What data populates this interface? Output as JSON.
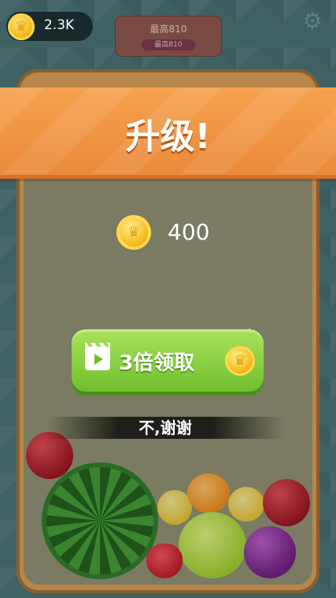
{
  "hud": {
    "coin_balance": "2.3K",
    "best_title": "最高810",
    "best_sub": "最高810"
  },
  "icons": {
    "coin": "coin-crown-icon",
    "settings": "gear-icon",
    "video": "video-clapper-icon"
  },
  "banner": {
    "title": "升级!"
  },
  "reward": {
    "amount": "400"
  },
  "buttons": {
    "triple_label": "3倍领取",
    "no_thanks": "不,谢谢"
  },
  "colors": {
    "banner": "#ea8a3a",
    "button": "#6fbf2d",
    "board": "#b9864a"
  }
}
